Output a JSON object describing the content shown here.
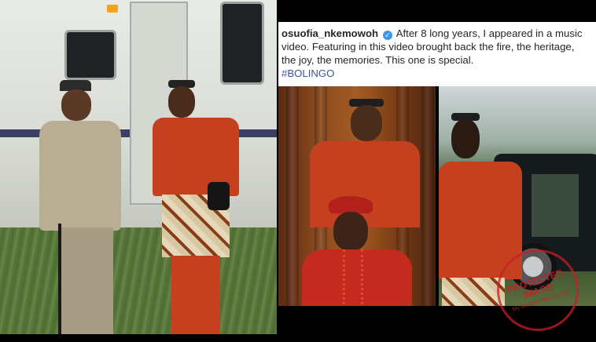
{
  "caption": {
    "username": "osuofia_nkemowoh",
    "text": "After 8 long years, I appeared in a music video. Featuring in this video brought back the fire, the heritage, the joy, the memories. This one is special.",
    "hashtag": "#BOLINGO"
  },
  "watermark": {
    "main_text": "PROTECTED IMAGE",
    "sub_text": "My Website News & Info"
  },
  "colors": {
    "verified_badge": "#3897f0",
    "hashtag": "#385898",
    "suit_red": "#c4401f",
    "watermark_red": "#c81e28"
  }
}
